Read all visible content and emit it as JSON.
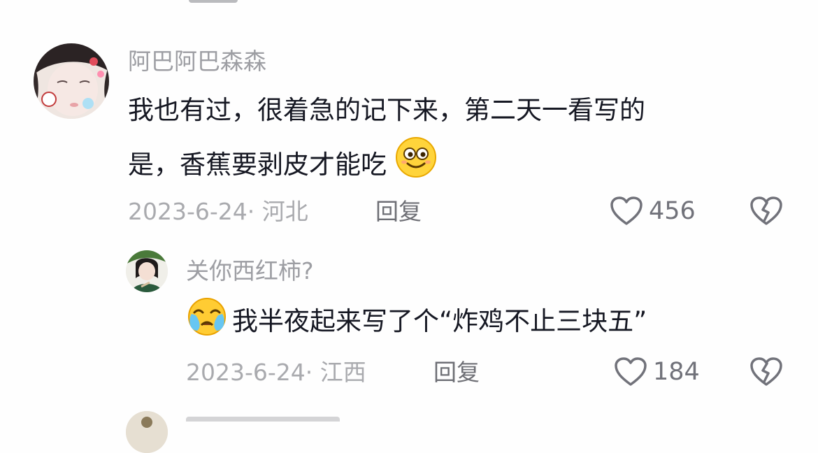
{
  "comments": [
    {
      "username": "阿巴阿巴森森",
      "text_line1": "我也有过，很着急的记下来，第二天一看写的",
      "text_line2": "是，香蕉要剥皮才能吃",
      "date": "2023-6-24",
      "location": "· 河北",
      "reply_label": "回复",
      "likes": "456",
      "emoji_icon": "smile-emoji-icon"
    },
    {
      "username": "关你西红柿?",
      "text": "我半夜起来写了个“炸鸡不止三块五”",
      "date": "2023-6-24",
      "location": "· 江西",
      "reply_label": "回复",
      "likes": "184",
      "emoji_icon": "crying-emoji-icon"
    }
  ],
  "colors": {
    "username": "#9d9ea3",
    "text": "#161823",
    "meta": "#a9aaae",
    "icon": "#71727a"
  }
}
